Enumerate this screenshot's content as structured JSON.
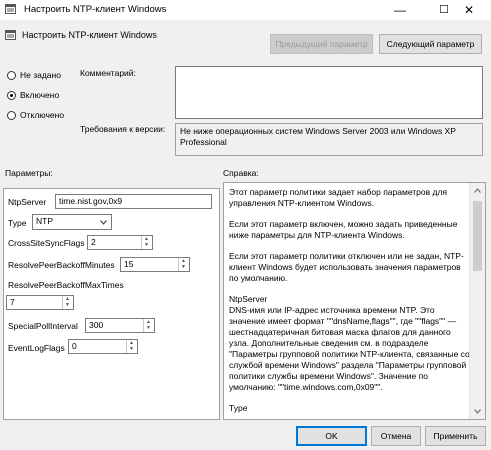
{
  "window": {
    "title": "Настроить NTP-клиент Windows",
    "minimize_glyph": "—",
    "maximize_glyph": "☐",
    "close_glyph": "✕"
  },
  "header": {
    "policy_name": "Настроить NTP-клиент Windows",
    "prev_button": "Предыдущий параметр",
    "next_button": "Следующий параметр"
  },
  "state": {
    "options": [
      "Не задано",
      "Включено",
      "Отключено"
    ],
    "selected": "Включено"
  },
  "comment": {
    "label": "Комментарий:",
    "value": ""
  },
  "requirements": {
    "label": "Требования к версии:",
    "value": "Не ниже операционных систем Windows Server 2003 или Windows XP Professional"
  },
  "params": {
    "label": "Параметры:",
    "ntpserver_label": "NtpServer",
    "ntpserver_value": "time.nist.gov,0x9",
    "type_label": "Type",
    "type_value": "NTP",
    "crosssite_label": "CrossSiteSyncFlags",
    "crosssite_value": "2",
    "resolvepeer_label": "ResolvePeerBackoffMinutes",
    "resolvepeer_value": "15",
    "resolvemax_label": "ResolvePeerBackoffMaxTimes",
    "resolvemax_value": "7",
    "specialpoll_label": "SpecialPollInterval",
    "specialpoll_value": "300",
    "eventlog_label": "EventLogFlags",
    "eventlog_value": "0"
  },
  "help": {
    "label": "Справка:",
    "paragraphs": [
      "Этот параметр политики задает набор параметров для управления NTP-клиентом Windows.",
      "Если этот параметр включен, можно задать приведенные ниже параметры для NTP-клиента Windows.",
      "Если этот параметр политики отключен или не задан, NTP-клиент Windows будет использовать значения параметров по умолчанию.",
      "NtpServer\nDNS-имя или IP-адрес источника времени NTP. Это значение имеет формат \"\"dnsName,flags\"\", где \"\"flags\"\" — шестнадцатеричная битовая маска флагов для данного узла. Дополнительные сведения см. в подразделе \"Параметры групповой политики NTP-клиента, связанные со службой времени Windows\" раздела \"Параметры групповой политики службы времени Windows\". Значение по умолчанию: \"\"time.windows.com,0x09\"\".",
      "Type"
    ]
  },
  "footer": {
    "ok": "OK",
    "cancel": "Отмена",
    "apply": "Применить"
  }
}
